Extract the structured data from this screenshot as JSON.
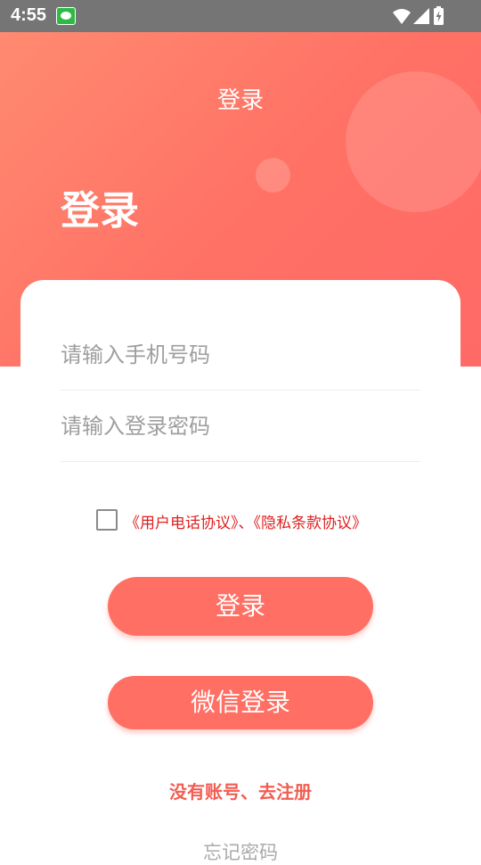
{
  "status_bar": {
    "time": "4:55",
    "notification_icon": "app-notification-icon",
    "icons": [
      "wifi-icon",
      "cellular-signal-icon",
      "battery-charging-icon"
    ]
  },
  "header": {
    "nav_title": "登录",
    "hero_title": "登录"
  },
  "form": {
    "phone": {
      "value": "",
      "placeholder": "请输入手机号码"
    },
    "password": {
      "value": "",
      "placeholder": "请输入登录密码"
    }
  },
  "agreement": {
    "checked": false,
    "text": "《用户电话协议》、《隐私条款协议》"
  },
  "actions": {
    "login_label": "登录",
    "wechat_login_label": "微信登录",
    "register_label": "没有账号、去注册",
    "forgot_password_label": "忘记密码"
  },
  "colors": {
    "accent": "#ff6f64",
    "header_gradient_start": "#ff8a70",
    "header_gradient_end": "#ff6a66",
    "agreement_text": "#e02020",
    "register_text": "#f25d52",
    "status_bar": "#757575"
  }
}
